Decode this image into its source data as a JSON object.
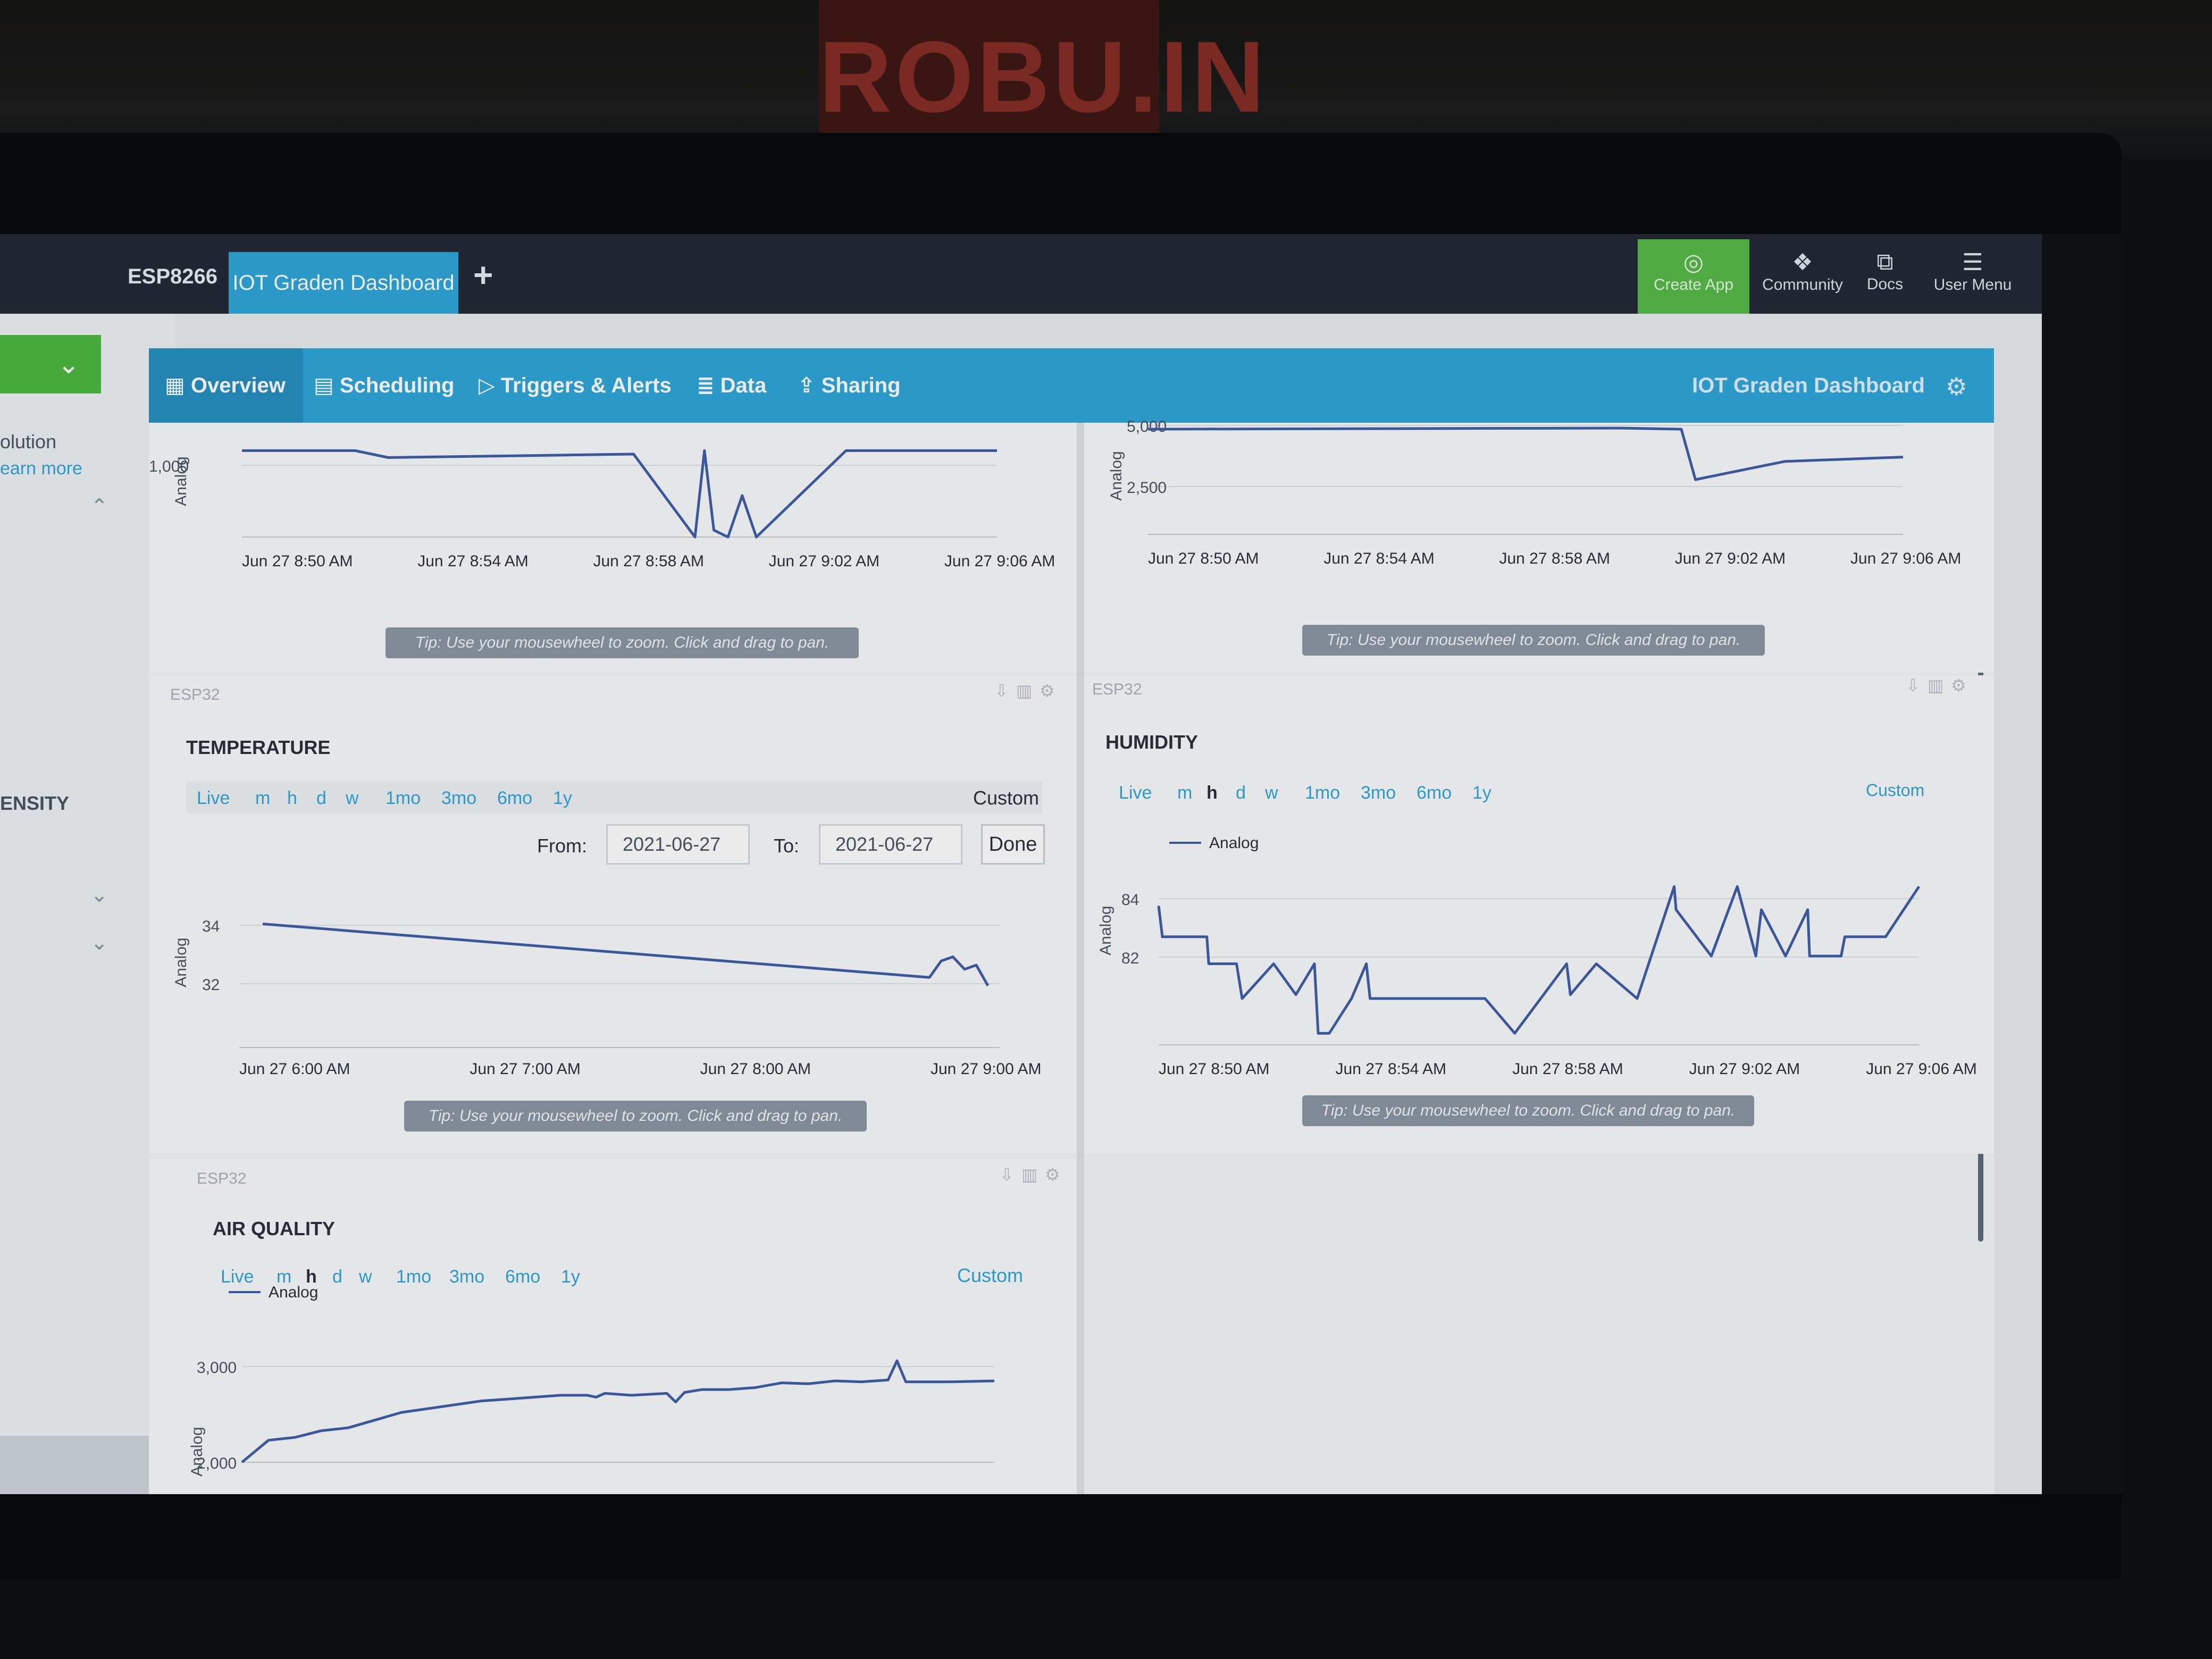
{
  "background": {
    "box_logo": "ROBU.IN"
  },
  "topbar": {
    "device_tab": "ESP8266",
    "dashboard_tab": "IOT Graden Dashboard",
    "add_tab": "+",
    "nav": [
      {
        "label": "Create App",
        "icon": "create-app-icon"
      },
      {
        "label": "Community",
        "icon": "chat-bubbles-icon"
      },
      {
        "label": "Docs",
        "icon": "docs-icon"
      },
      {
        "label": "User Menu",
        "icon": "hamburger-menu-icon"
      }
    ]
  },
  "left_panel": {
    "lines": [
      "olution",
      "earn more",
      "ENSITY"
    ]
  },
  "subnav": {
    "items": [
      {
        "label": "Overview",
        "icon": "grid-icon",
        "active": true
      },
      {
        "label": "Scheduling",
        "icon": "calendar-icon"
      },
      {
        "label": "Triggers & Alerts",
        "icon": "play-circle-icon"
      },
      {
        "label": "Data",
        "icon": "database-icon"
      },
      {
        "label": "Sharing",
        "icon": "share-icon"
      }
    ],
    "title": "IOT Graden Dashboard"
  },
  "tip_text": "Tip: Use your mousewheel to zoom. Click and drag to pan.",
  "ranges": [
    "Live",
    "m",
    "h",
    "d",
    "w",
    "1mo",
    "3mo",
    "6mo",
    "1y"
  ],
  "widgets": {
    "top_left": {
      "ylabel": "Analog"
    },
    "top_right": {
      "ylabel": "Analog"
    },
    "temperature": {
      "device": "ESP32",
      "title": "TEMPERATURE",
      "custom_label": "Custom",
      "from_label": "From:",
      "from_value": "2021-06-27",
      "to_label": "To:",
      "to_value": "2021-06-27",
      "done_label": "Done",
      "ylabel": "Analog"
    },
    "humidity": {
      "device": "ESP32",
      "title": "HUMIDITY",
      "custom_label": "Custom",
      "selected_range": "h",
      "legend": "Analog",
      "ylabel": "Analog"
    },
    "air_quality": {
      "device": "ESP32",
      "title": "AIR QUALITY",
      "custom_label": "Custom",
      "selected_range": "h",
      "legend": "Analog",
      "ylabel": "Analog"
    }
  },
  "chart_data": [
    {
      "id": "top_left",
      "type": "line",
      "ylabel": "Analog",
      "x_ticks": [
        "Jun 27 8:50 AM",
        "Jun 27 8:54 AM",
        "Jun 27 8:58 AM",
        "Jun 27 9:02 AM",
        "Jun 27 9:06 AM"
      ],
      "y_ticks": [
        "1,000"
      ],
      "ylim": [
        0,
        1200
      ],
      "x": [
        0,
        2.4,
        3.1,
        8.3,
        9.6,
        9.8,
        10.0,
        10.3,
        10.6,
        10.9,
        12.8,
        13.4,
        16
      ],
      "y": [
        1000,
        1000,
        920,
        960,
        0,
        1000,
        80,
        0,
        480,
        0,
        1000,
        1000,
        1000
      ],
      "xlim": [
        0,
        16
      ]
    },
    {
      "id": "top_right",
      "type": "line",
      "ylabel": "Analog",
      "x_ticks": [
        "Jun 27 8:50 AM",
        "Jun 27 8:54 AM",
        "Jun 27 8:58 AM",
        "Jun 27 9:02 AM",
        "Jun 27 9:06 AM"
      ],
      "y_ticks": [
        "5,000",
        "2,500"
      ],
      "ylim": [
        0,
        5200
      ],
      "x": [
        0,
        10,
        11.3,
        11.6,
        12.6,
        13.5,
        16
      ],
      "y": [
        4900,
        4950,
        4900,
        2550,
        3000,
        3400,
        3600
      ],
      "xlim": [
        0,
        16
      ]
    },
    {
      "id": "temperature",
      "type": "line",
      "ylabel": "Analog",
      "x_ticks": [
        "Jun 27 6:00 AM",
        "Jun 27 7:00 AM",
        "Jun 27 8:00 AM",
        "Jun 27 9:00 AM"
      ],
      "y_ticks": [
        "34",
        "32"
      ],
      "ylim": [
        31,
        35
      ],
      "x": [
        6.1,
        8.95,
        9.0,
        9.05,
        9.1,
        9.15,
        9.2
      ],
      "y": [
        34.0,
        32.7,
        33.1,
        33.2,
        32.9,
        33.0,
        32.5
      ],
      "xlim": [
        6.0,
        9.25
      ]
    },
    {
      "id": "humidity",
      "type": "line",
      "series": [
        {
          "name": "Analog"
        }
      ],
      "ylabel": "Analog",
      "x_ticks": [
        "Jun 27 8:50 AM",
        "Jun 27 8:54 AM",
        "Jun 27 8:58 AM",
        "Jun 27 9:02 AM",
        "Jun 27 9:06 AM"
      ],
      "y_ticks": [
        "84",
        "82"
      ],
      "ylim": [
        80.8,
        85
      ],
      "x": [
        0,
        0.1,
        1.3,
        1.35,
        2.1,
        2.25,
        3.1,
        3.7,
        4.2,
        4.3,
        4.6,
        5.2,
        5.6,
        5.7,
        8.8,
        9.6,
        11,
        11.1,
        11.8,
        12.9,
        13.9,
        13.95,
        14.9,
        15.6,
        16.1,
        16.25,
        16.9,
        17.5,
        17.55,
        18.4,
        18.5,
        19.6,
        20.5
      ],
      "y": [
        84.4,
        83.6,
        83.6,
        82.9,
        82.9,
        82.0,
        82.9,
        82.1,
        82.9,
        81.1,
        81.1,
        82.0,
        82.9,
        82.0,
        82.0,
        81.1,
        82.9,
        82.1,
        82.9,
        82.0,
        84.9,
        84.3,
        83.1,
        84.9,
        83.1,
        84.3,
        83.1,
        84.3,
        83.1,
        83.1,
        83.6,
        83.6,
        84.9
      ],
      "xlim": [
        0,
        20.5
      ]
    },
    {
      "id": "air_quality",
      "type": "line",
      "series": [
        {
          "name": "Analog"
        }
      ],
      "ylabel": "Analog",
      "y_ticks": [
        "3,000",
        "2,000"
      ],
      "ylim": [
        2000,
        3000
      ],
      "x": [
        0,
        3,
        6,
        9,
        12,
        15,
        18,
        21,
        24,
        27,
        30,
        33,
        36,
        39,
        40,
        41,
        44,
        48,
        49,
        50,
        52,
        55,
        58,
        61,
        64,
        67,
        70,
        73,
        74,
        75,
        80,
        85
      ],
      "y": [
        2000,
        2230,
        2260,
        2330,
        2360,
        2440,
        2520,
        2560,
        2600,
        2640,
        2660,
        2680,
        2700,
        2700,
        2680,
        2720,
        2700,
        2720,
        2630,
        2730,
        2760,
        2760,
        2780,
        2830,
        2820,
        2850,
        2840,
        2860,
        3060,
        2840,
        2840,
        2850
      ],
      "xlim": [
        0,
        85
      ]
    }
  ]
}
